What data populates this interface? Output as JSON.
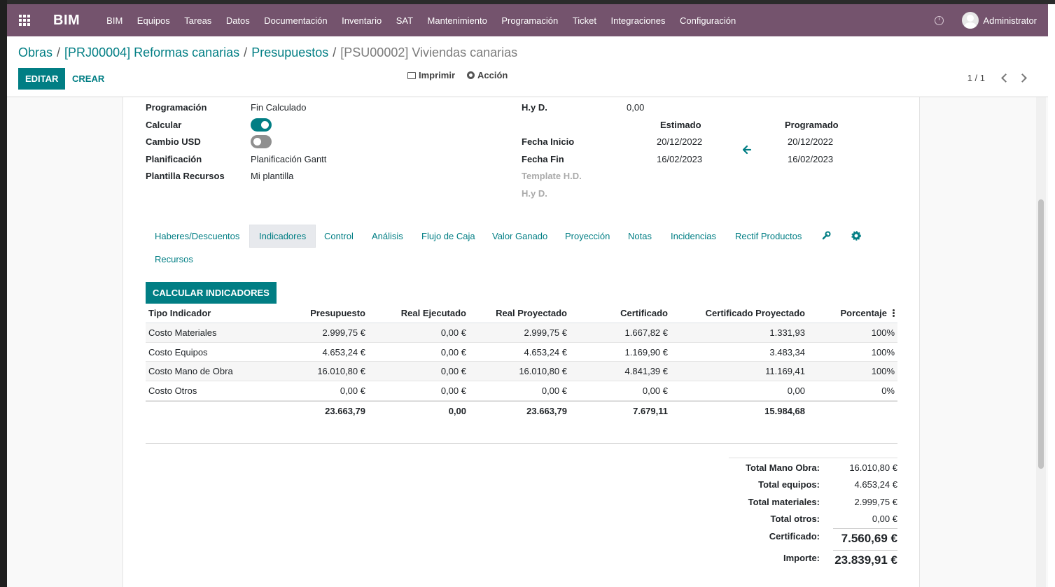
{
  "navbar": {
    "brand": "BIM",
    "menu": [
      "BIM",
      "Equipos",
      "Tareas",
      "Datos",
      "Documentación",
      "Inventario",
      "SAT",
      "Mantenimiento",
      "Programación",
      "Ticket",
      "Integraciones",
      "Configuración"
    ],
    "user": "Administrator",
    "colors": {
      "navbar": "#74536d",
      "accent": "#017e84"
    }
  },
  "breadcrumb": {
    "items": [
      "Obras",
      "[PRJ00004] Reformas canarias",
      "Presupuestos"
    ],
    "current": "[PSU00002] Viviendas canarias"
  },
  "control": {
    "edit": "EDITAR",
    "create": "CREAR",
    "print": "Imprimir",
    "action": "Acción",
    "pager": "1 / 1"
  },
  "form_left": {
    "programacion_label": "Programación",
    "programacion_value": "Fin Calculado",
    "calcular_label": "Calcular",
    "calcular_on": true,
    "cambio_label": "Cambio USD",
    "cambio_on": false,
    "planificacion_label": "Planificación",
    "planificacion_value": "Planificación Gantt",
    "plantilla_label": "Plantilla Recursos",
    "plantilla_value": "Mi plantilla"
  },
  "form_right": {
    "hyd_label": "H.y D.",
    "hyd_value": "0,00",
    "col_estimado": "Estimado",
    "col_programado": "Programado",
    "fecha_inicio_label": "Fecha Inicio",
    "fecha_inicio_est": "20/12/2022",
    "fecha_inicio_prog": "20/12/2022",
    "fecha_fin_label": "Fecha Fin",
    "fecha_fin_est": "16/02/2023",
    "fecha_fin_prog": "16/02/2023",
    "template_label": "Template H.D.",
    "hyd2_label": "H.y D."
  },
  "tabs": {
    "items": [
      "Haberes/Descuentos",
      "Indicadores",
      "Control",
      "Análisis",
      "Flujo de Caja",
      "Valor Ganado",
      "Proyección",
      "Notas",
      "Incidencias",
      "Rectif Productos"
    ],
    "second_row": "Recursos",
    "active": "Indicadores"
  },
  "indicators": {
    "button": "CALCULAR INDICADORES",
    "headers": [
      "Tipo Indicador",
      "Presupuesto",
      "Real Ejecutado",
      "Real Proyectado",
      "Certificado",
      "Certificado Proyectado",
      "Porcentaje"
    ],
    "rows": [
      [
        "Costo Materiales",
        "2.999,75 €",
        "0,00 €",
        "2.999,75 €",
        "1.667,82 €",
        "1.331,93",
        "100%"
      ],
      [
        "Costo Equipos",
        "4.653,24 €",
        "0,00 €",
        "4.653,24 €",
        "1.169,90 €",
        "3.483,34",
        "100%"
      ],
      [
        "Costo Mano de Obra",
        "16.010,80 €",
        "0,00 €",
        "16.010,80 €",
        "4.841,39 €",
        "11.169,41",
        "100%"
      ],
      [
        "Costo Otros",
        "0,00 €",
        "0,00 €",
        "0,00 €",
        "0,00 €",
        "0,00",
        "0%"
      ]
    ],
    "totals": [
      "23.663,79",
      "0,00",
      "23.663,79",
      "7.679,11",
      "15.984,68"
    ]
  },
  "summary": {
    "mano_obra_label": "Total Mano Obra:",
    "mano_obra_value": "16.010,80 €",
    "equipos_label": "Total equipos:",
    "equipos_value": "4.653,24 €",
    "materiales_label": "Total materiales:",
    "materiales_value": "2.999,75 €",
    "otros_label": "Total otros:",
    "otros_value": "0,00 €",
    "certificado_label": "Certificado:",
    "certificado_value": "7.560,69 €",
    "importe_label": "Importe:",
    "importe_value": "23.839,91 €"
  }
}
